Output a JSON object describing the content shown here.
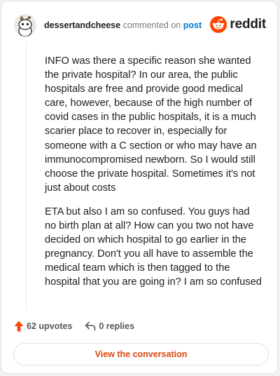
{
  "header": {
    "username": "dessertandcheese",
    "verb": "commented on",
    "post_link": "post",
    "brand": "reddit"
  },
  "comment": {
    "paragraphs": [
      "INFO was there a specific reason she wanted the private hospital? In our area, the public hospitals are free and provide good medical care, however, because of the high number of covid cases in the public hospitals, it is a much scarier place to recover in, especially for someone with a C section or who may have an immunocompromised newborn. So I would still choose the private hospital. Sometimes it's not just about costs",
      "ETA but also I am so confused. You guys had no birth plan at all? How can you two not have decided on which hospital to go earlier in the pregnancy. Don't you all have to assemble the medical team which is then tagged to the hospital that you are going in? I am so confused"
    ]
  },
  "actions": {
    "upvotes": "62 upvotes",
    "replies": "0 replies"
  },
  "footer": {
    "view_button": "View the conversation"
  },
  "colors": {
    "brand_orange": "#ff4500",
    "link_blue": "#0079d3",
    "button_text": "#d9480f"
  },
  "icons": {
    "avatar": "reddit-snoo-avatar",
    "logo": "reddit-logo-icon",
    "upvote": "upvote-arrow-icon",
    "reply": "reply-arrow-icon"
  }
}
